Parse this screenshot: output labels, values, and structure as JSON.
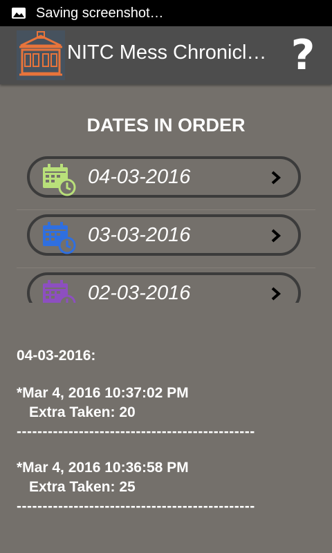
{
  "statusbar": {
    "text": "Saving screenshot…"
  },
  "appbar": {
    "title": "NITC Mess Chronicl…",
    "help": "?"
  },
  "heading": "DATES IN ORDER",
  "dates": [
    {
      "label": "04-03-2016",
      "icon_color": "#b9e07a"
    },
    {
      "label": "03-03-2016",
      "icon_color": "#2f6fe0"
    },
    {
      "label": "02-03-2016",
      "icon_color": "#8d4fc0"
    }
  ],
  "details": {
    "date_heading": "04-03-2016:",
    "entries": [
      {
        "timestamp": "*Mar 4, 2016 10:37:02 PM",
        "extra": "Extra Taken: 20"
      },
      {
        "timestamp": "*Mar 4, 2016 10:36:58 PM",
        "extra": "Extra Taken: 25"
      }
    ],
    "separator": "----------------------------------------------"
  }
}
